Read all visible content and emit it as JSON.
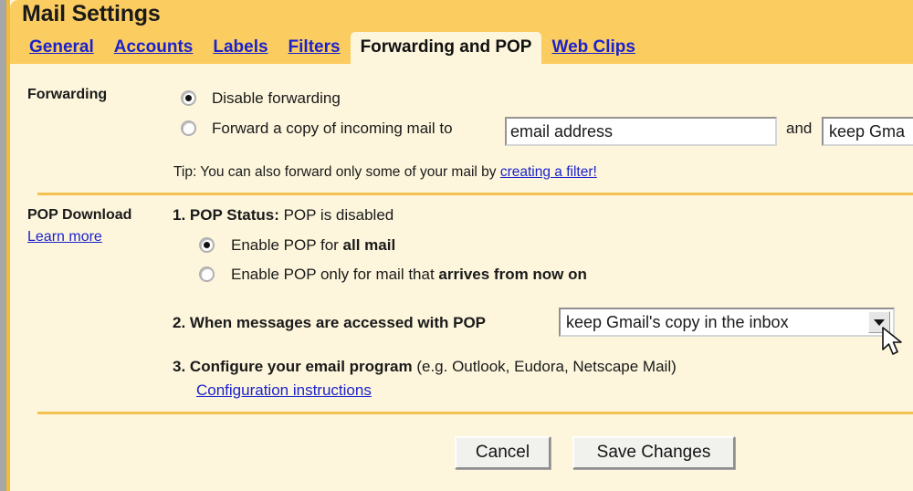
{
  "window": {
    "title": "Mail Settings"
  },
  "tabs": [
    {
      "label": "General",
      "active": false
    },
    {
      "label": "Accounts",
      "active": false
    },
    {
      "label": "Labels",
      "active": false
    },
    {
      "label": "Filters",
      "active": false
    },
    {
      "label": "Forwarding and POP",
      "active": true
    },
    {
      "label": "Web Clips",
      "active": false
    }
  ],
  "forwarding": {
    "section_label": "Forwarding",
    "option_disable": "Disable forwarding",
    "option_forward_prefix": "Forward a copy of incoming mail to",
    "selected_option": "disable",
    "email_input": {
      "value": "email address",
      "placeholder": "email address"
    },
    "and_label": "and",
    "keep_dropdown": {
      "selected": "keep Gmail's copy in the inbox",
      "truncated_display": "keep Gma"
    },
    "tip_prefix": "Tip: You can also forward only some of your mail by ",
    "tip_link": "creating a filter!"
  },
  "pop": {
    "section_label": "POP Download",
    "learn_more": "Learn more",
    "step1": {
      "number": "1.",
      "label": "POP Status:",
      "status": "POP is disabled",
      "option_all_prefix": "Enable POP for ",
      "option_all_bold": "all mail",
      "option_now_prefix": "Enable POP only for mail that ",
      "option_now_bold": "arrives from now on",
      "selected_option": "all"
    },
    "step2": {
      "number": "2.",
      "label": "When messages are accessed with POP",
      "dropdown_selected": "keep Gmail's copy in the inbox"
    },
    "step3": {
      "number": "3.",
      "label_bold": "Configure your email program",
      "label_rest": " (e.g. Outlook, Eudora, Netscape Mail)",
      "link": "Configuration instructions"
    }
  },
  "footer": {
    "cancel_label": "Cancel",
    "save_label": "Save Changes"
  },
  "colors": {
    "header_bg": "#fbcd61",
    "body_bg": "#fdf6dc",
    "link": "#1b22cc",
    "divider": "#f3c250",
    "edge": "#f5bb34"
  }
}
